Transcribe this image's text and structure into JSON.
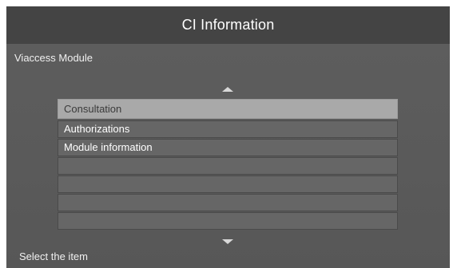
{
  "header": {
    "title": "CI Information"
  },
  "subtitle": "Viaccess Module",
  "list": {
    "items": [
      {
        "label": "Consultation",
        "selected": true
      },
      {
        "label": "Authorizations",
        "selected": false
      },
      {
        "label": "Module information",
        "selected": false
      },
      {
        "label": "",
        "selected": false
      },
      {
        "label": "",
        "selected": false
      },
      {
        "label": "",
        "selected": false
      },
      {
        "label": "",
        "selected": false
      }
    ]
  },
  "footer": {
    "hint": "Select the item"
  },
  "icons": {
    "scroll_up": "triangle-up-icon",
    "scroll_down": "triangle-down-icon"
  },
  "colors": {
    "header_bg": "#444444",
    "body_bg": "#5c5c5c",
    "selected_bg": "#a9a9a9"
  }
}
